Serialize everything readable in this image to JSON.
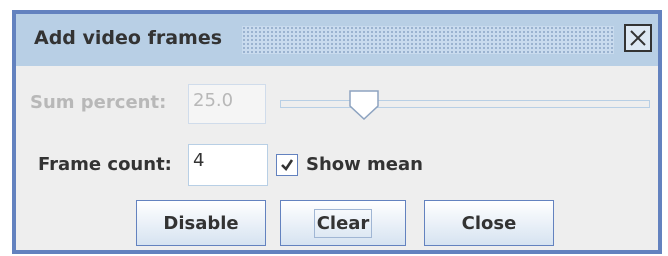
{
  "window": {
    "title": "Add video frames",
    "close_icon": "close-x-icon"
  },
  "sum_percent": {
    "label": "Sum percent:",
    "value": "25.0",
    "enabled": false,
    "slider_percent": 25
  },
  "frame_count": {
    "label": "Frame count:",
    "value": "4"
  },
  "show_mean": {
    "label": "Show mean",
    "checked": true
  },
  "buttons": {
    "disable": "Disable",
    "clear": "Clear",
    "close": "Close"
  },
  "colors": {
    "titlebar": "#b8cfe5",
    "border": "#6382bf",
    "panel": "#eeeeee",
    "disabled_text": "#b8b8b8"
  }
}
